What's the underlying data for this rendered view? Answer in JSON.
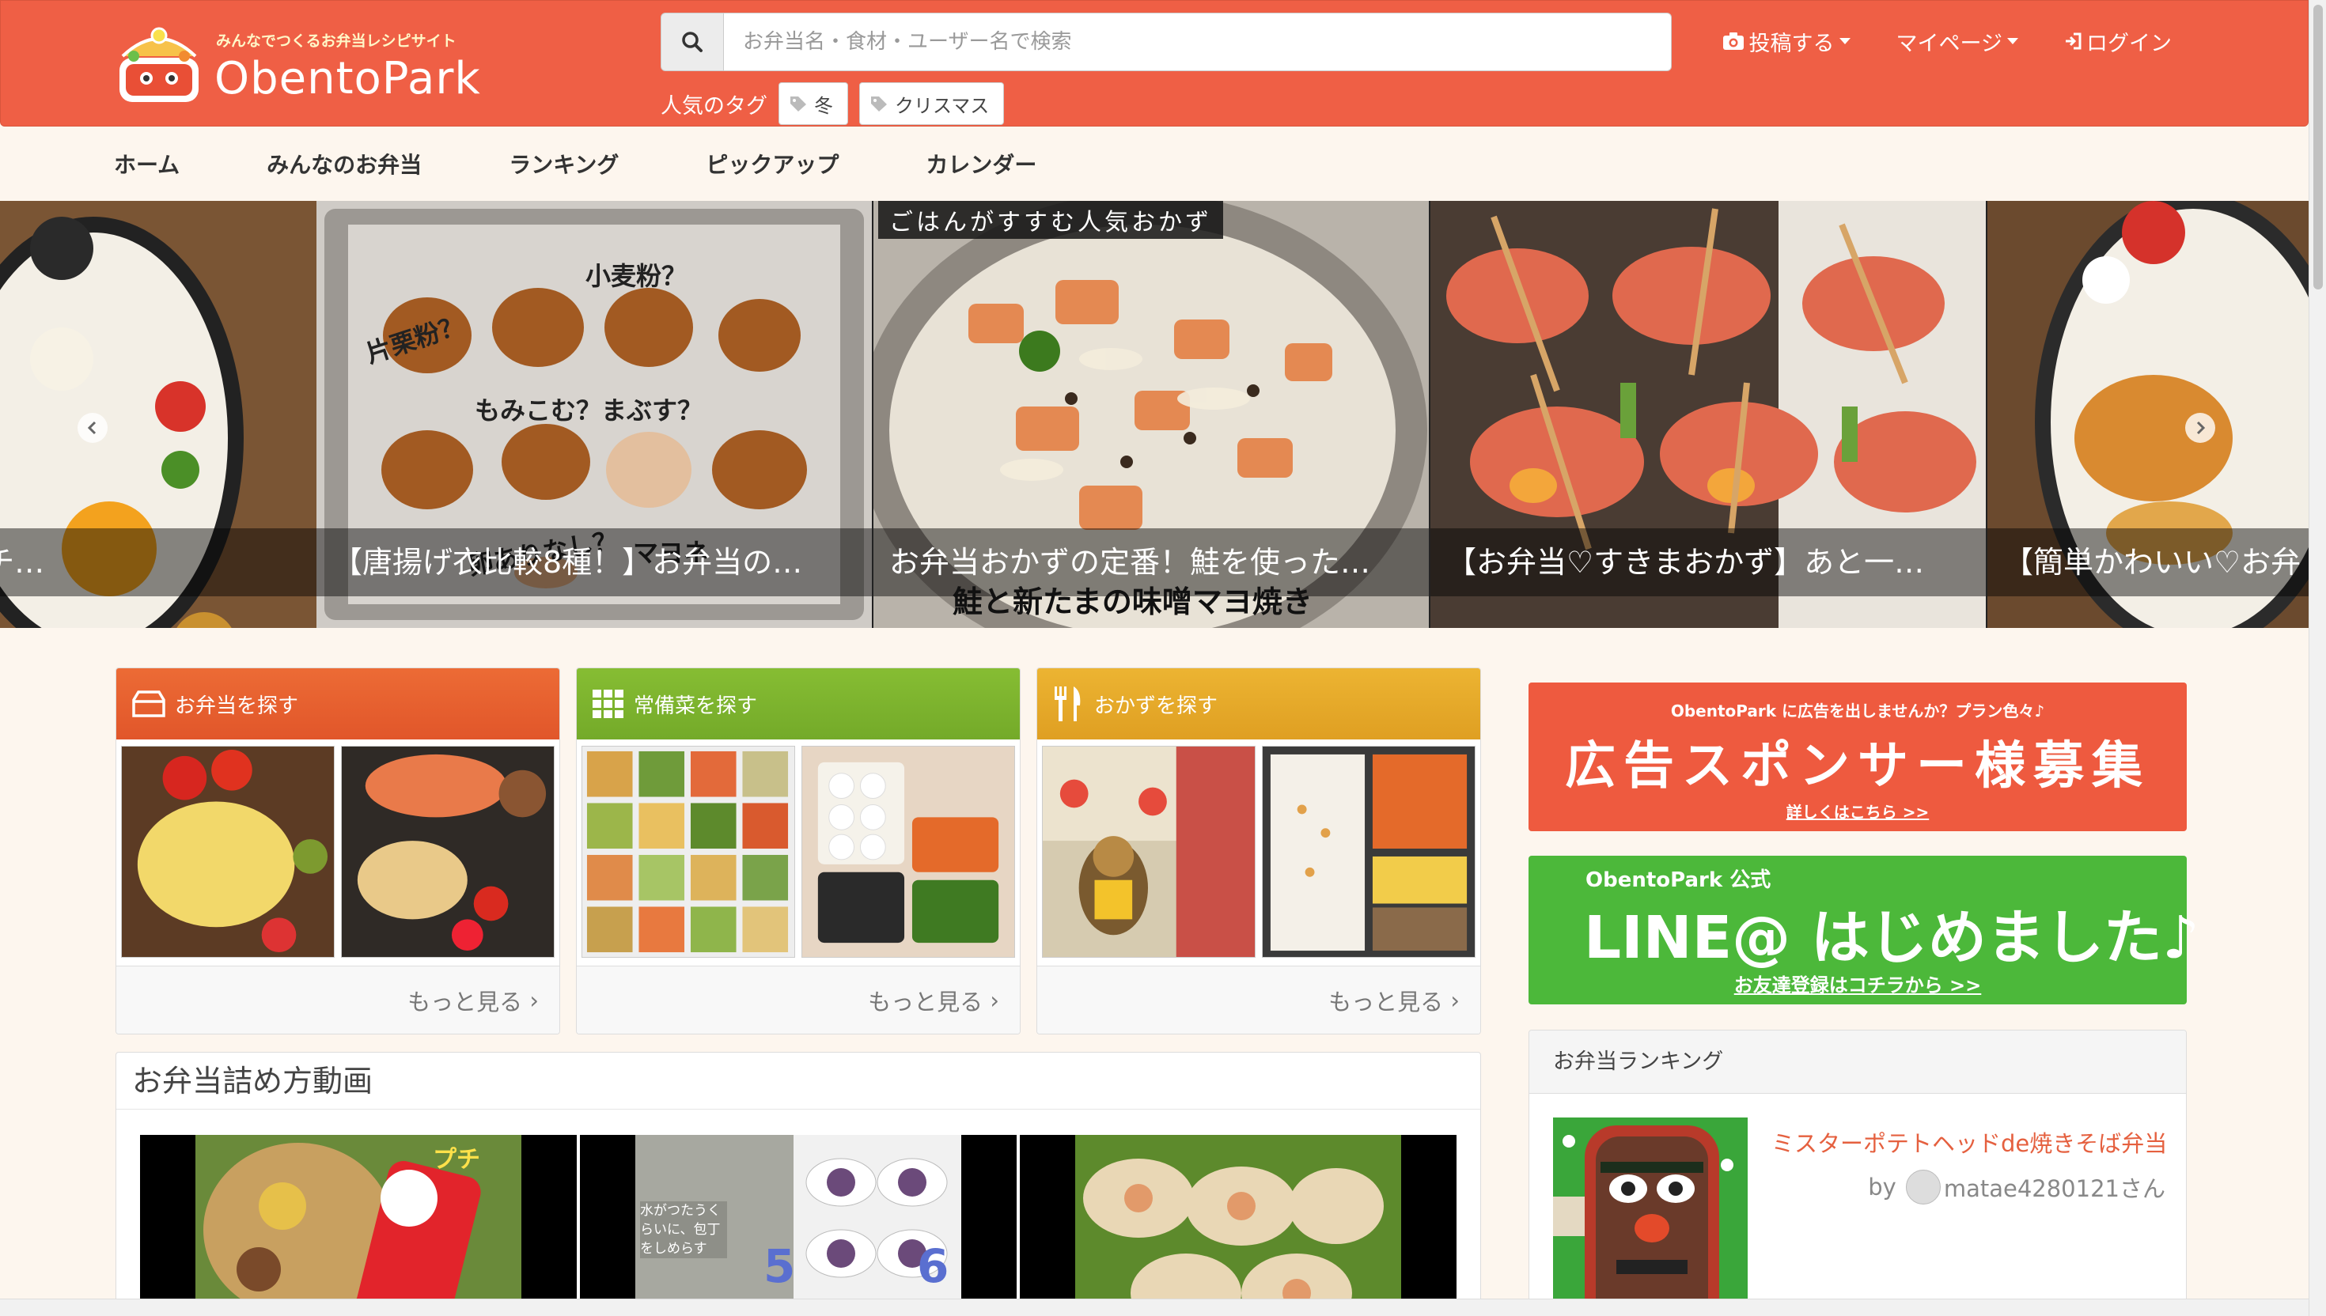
{
  "header": {
    "logo_tagline": "みんなでつくるお弁当レシピサイト",
    "logo_name": "ObentoPark",
    "search_placeholder": "お弁当名・食材・ユーザー名で検索",
    "popular_label": "人気のタグ",
    "tags": [
      "冬",
      "クリスマス"
    ],
    "nav": {
      "post": "投稿する",
      "mypage": "マイページ",
      "login": "ログイン"
    },
    "colors": {
      "bar": "#ef5f45"
    }
  },
  "mainnav": {
    "items": [
      "ホーム",
      "みんなのお弁当",
      "ランキング",
      "ピックアップ",
      "カレンダー"
    ]
  },
  "carousel": {
    "slides": [
      {
        "caption": "♡お弁当】レンチ…"
      },
      {
        "caption": "【唐揚げ衣比較8種！】お弁当の…",
        "hand_texts": [
          "小麦粉？",
          "片栗粉？",
          "もみこむ？まぶす？",
          "卵ありなし？",
          "マヨネ"
        ]
      },
      {
        "caption": "お弁当おかずの定番！鮭を使った…",
        "banner": "ごはんがすすむ人気おかず",
        "subtitle": "鮭と新たまの味噌マヨ焼き"
      },
      {
        "caption": "【お弁当♡すきまおかず】あと一…"
      },
      {
        "caption": "【簡単かわいい♡お弁"
      }
    ]
  },
  "categories": [
    {
      "title": "お弁当を探す",
      "more": "もっと見る",
      "color": "#e8602f",
      "icon": "bento-box-icon"
    },
    {
      "title": "常備菜を探す",
      "more": "もっと見る",
      "color": "#7cb32f",
      "icon": "grid-icon"
    },
    {
      "title": "おかずを探す",
      "more": "もっと見る",
      "color": "#e5ab27",
      "icon": "fork-knife-icon"
    }
  ],
  "video_section": {
    "title": "お弁当詰め方動画",
    "thumb_texts": {
      "v1_label": "プチ",
      "v2_label": "水がつたうくらいに、包丁をしめらす",
      "v2_step_a": "5",
      "v2_step_b": "6"
    }
  },
  "ads": {
    "sponsor": {
      "small": "ObentoPark に広告を出しませんか？プラン色々♪",
      "big": "広告スポンサー様募集",
      "link": "詳しくはこちら >>"
    },
    "line": {
      "small": "ObentoPark 公式",
      "big": "LINE@ はじめました♪",
      "link": "お友達登録はコチラから >>"
    }
  },
  "ranking": {
    "title": "お弁当ランキング",
    "items": [
      {
        "title": "ミスターポテトヘッドde焼きそば弁当",
        "by": "by",
        "user": "matae4280121さん"
      }
    ]
  }
}
